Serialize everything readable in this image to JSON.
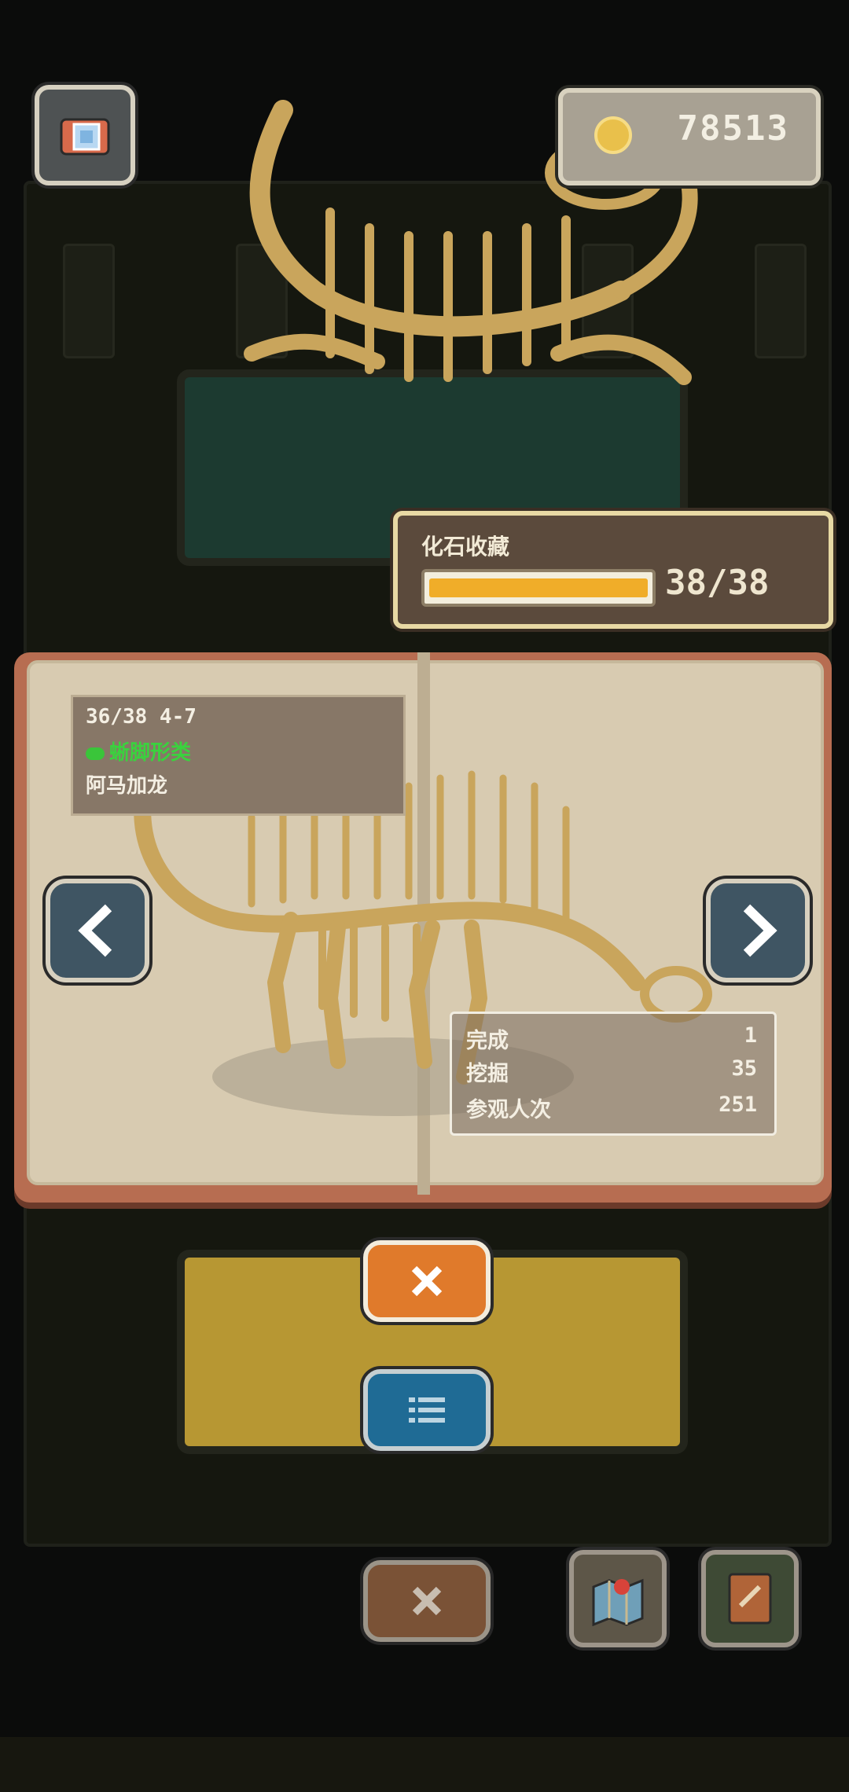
{
  "hud": {
    "coins": "78513"
  },
  "collection": {
    "title": "化石收藏",
    "count": "38/38",
    "progress": 1.0
  },
  "book": {
    "fossil_id": "36/38 4-7",
    "fossil_class": "蜥脚形类",
    "fossil_name": "阿马加龙",
    "stats": [
      {
        "label": "完成",
        "value": "1"
      },
      {
        "label": "挖掘",
        "value": "35"
      },
      {
        "label": "参观人次",
        "value": "251"
      }
    ]
  },
  "icons": {
    "camera": "camera-icon",
    "coin": "coin-icon",
    "prev": "chevron-left-icon",
    "next": "chevron-right-icon",
    "close": "close-icon",
    "list": "list-icon",
    "map": "map-icon",
    "journal": "journal-icon"
  },
  "colors": {
    "accent_orange": "#e07a2b",
    "progress_fill": "#f0ad29",
    "class_green": "#3ad23e",
    "list_blue": "#1f6b95"
  }
}
